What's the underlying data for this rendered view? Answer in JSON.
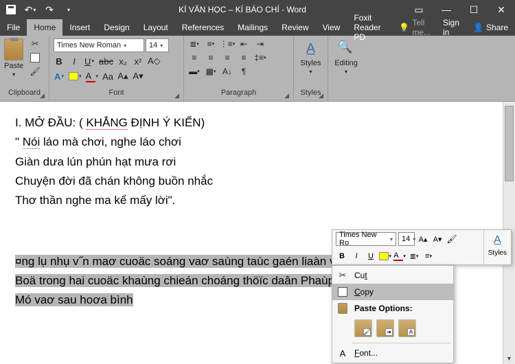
{
  "titlebar": {
    "title": "KÍ VĂN HỌC – KÍ BÁO CHÍ  - Word"
  },
  "menubar": {
    "tabs": [
      "File",
      "Home",
      "Insert",
      "Design",
      "Layout",
      "References",
      "Mailings",
      "Review",
      "View",
      "Foxit Reader PD"
    ],
    "active_index": 1,
    "tell_me": "Tell me...",
    "sign_in": "Sign in",
    "share": "Share"
  },
  "ribbon": {
    "clipboard": {
      "label": "Clipboard",
      "paste": "Paste"
    },
    "font": {
      "label": "Font",
      "name": "Times New Roman",
      "size": "14",
      "bold": "B",
      "italic": "I",
      "underline": "U",
      "strike": "abc",
      "sub": "x₂",
      "sup": "x²",
      "caseAa": "Aa",
      "clear": "A"
    },
    "paragraph": {
      "label": "Paragraph"
    },
    "styles": {
      "label": "Styles",
      "button": "Styles"
    },
    "editing": {
      "label": "",
      "button": "Editing"
    }
  },
  "document": {
    "lines": [
      {
        "pre": "I. MỞ ĐẦU: ( ",
        "spell": "KHẲNG",
        "post": " ĐỊNH Ý KIẾN)"
      },
      {
        "q": "\" ",
        "gram": "Nói",
        "post": " láo mà chơi, nghe láo chơi"
      },
      {
        "plain": "Giàn dưa lún phún hạt mưa rơi"
      },
      {
        "plain": "Chuyện đời đã chán không buồn nhắc"
      },
      {
        "plain": "Thơ thần nghe ma kể mấy lời\"."
      }
    ],
    "selected": [
      "¤ng lụ nhụ v˝n maơ cuoäc soáng vaơ saùng taùc gaén liaàn vớ",
      "Boä trong hai cuoäc khaùng chieán choáng thöïc daân Phaùp, choáng ñeá quoác",
      "Mó vaơ sau hoơa bình "
    ]
  },
  "minitoolbar": {
    "font_name": "Times New Ro",
    "font_size": "14",
    "bold": "B",
    "italic": "I",
    "underline": "U",
    "styles": "Styles"
  },
  "contextmenu": {
    "cut": "Cut",
    "cut_key": "t",
    "copy": "Copy",
    "copy_key": "C",
    "paste_options": "Paste Options:",
    "font": "Font...",
    "font_key": "F",
    "paste_badges": [
      "",
      "",
      "A"
    ]
  }
}
